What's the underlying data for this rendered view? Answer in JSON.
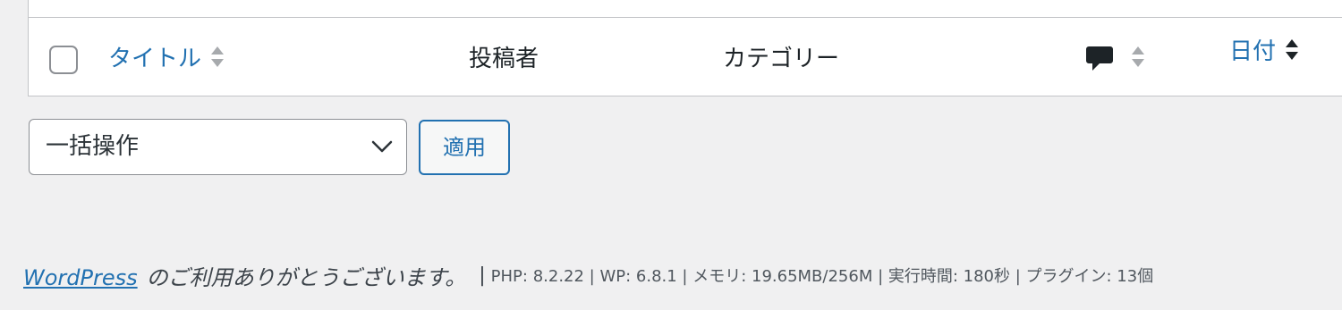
{
  "table": {
    "columns": {
      "title": "タイトル",
      "author": "投稿者",
      "categories": "カテゴリー",
      "date": "日付"
    }
  },
  "bulk_actions": {
    "selected": "一括操作",
    "apply_label": "適用"
  },
  "footer": {
    "wordpress_link": "WordPress",
    "thanks_text": "のご利用ありがとうございます。",
    "separator": "|",
    "server_info": "PHP: 8.2.22 | WP: 6.8.1 | メモリ: 19.65MB/256M | 実行時間: 180秒 | プラグイン: 13個"
  },
  "colors": {
    "link": "#2271b1",
    "background": "#f0f0f1",
    "border": "#c3c4c7"
  },
  "icons": [
    "sort-icon",
    "comment-bubble-icon",
    "chevron-down-icon"
  ]
}
